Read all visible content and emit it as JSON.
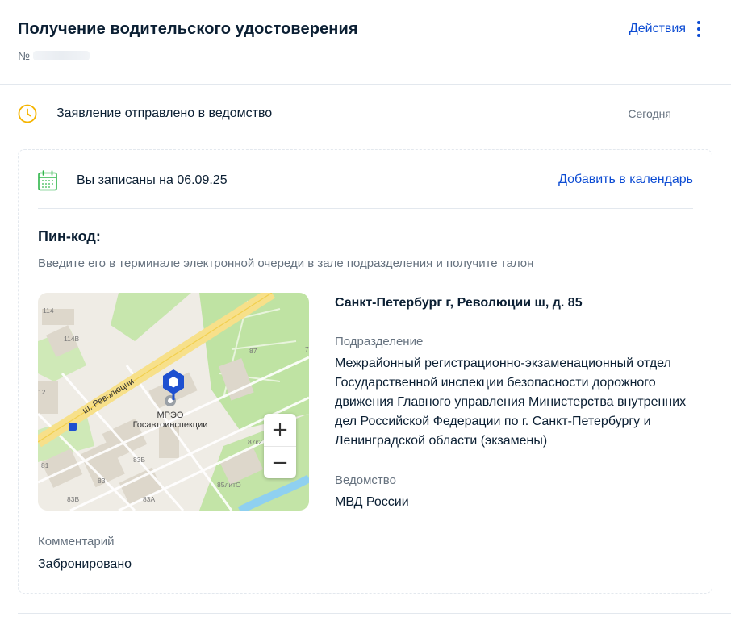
{
  "header": {
    "title": "Получение водительского удостоверения",
    "number_prefix": "№",
    "actions_label": "Действия"
  },
  "status": {
    "text": "Заявление отправлено в ведомство",
    "date": "Сегодня",
    "icon": "clock-icon",
    "icon_color": "#f5b400"
  },
  "appointment": {
    "text": "Вы записаны на 06.09.25",
    "add_to_calendar": "Добавить в календарь",
    "icon": "calendar-icon",
    "icon_color": "#2fb64a"
  },
  "pin": {
    "title": "Пин-код:",
    "hint": "Введите его в терминале электронной очереди в зале подразделения и получите талон"
  },
  "map": {
    "street_label": "ш. Революции",
    "poi_line1": "МРЭО",
    "poi_line2": "Госавтоинспекции",
    "house_labels": [
      "114",
      "114В",
      "87",
      "7",
      "12",
      "87к2",
      "81",
      "83Б",
      "83",
      "83В",
      "83А",
      "85литО"
    ],
    "zoom_in": "+",
    "zoom_out": "−",
    "marker_color": "#1e50d0"
  },
  "info": {
    "address": "Санкт-Петербург г, Революции ш, д. 85",
    "division_label": "Подразделение",
    "division_value": "Межрайонный регистрационно-экзаменационный отдел Государственной инспекции безопасности дорожного движения Главного управления Министерства внутренних дел Российской Федерации по г. Санкт-Петербургу и Ленинградской области (экзамены)",
    "department_label": "Ведомство",
    "department_value": "МВД России"
  },
  "comment": {
    "label": "Комментарий",
    "value": "Забронировано"
  },
  "colors": {
    "link": "#0d4cd3",
    "text": "#0b1f33",
    "muted": "#66727f"
  }
}
